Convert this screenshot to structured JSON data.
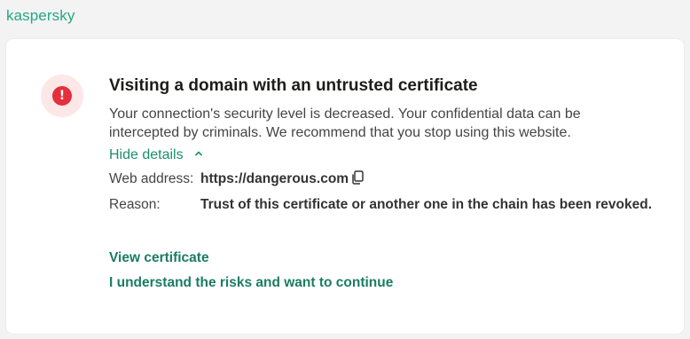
{
  "brand": {
    "name": "kaspersky",
    "color": "#23a884"
  },
  "alert": {
    "icon": "alert-circle-icon",
    "title": "Visiting a domain with an untrusted certificate",
    "description": "Your connection's security level is decreased. Your confidential data can be intercepted by criminals. We recommend that you stop using this website.",
    "toggle_label": "Hide details",
    "accent_color": "#e3303b"
  },
  "details": {
    "web_address_label": "Web address:",
    "web_address_value": "https://dangerous.com",
    "reason_label": "Reason:",
    "reason_value": "Trust of this certificate or another one in the chain has been revoked."
  },
  "actions": {
    "view_certificate": "View certificate",
    "continue": "I understand the risks and want to continue",
    "link_color": "#1b7c63"
  }
}
